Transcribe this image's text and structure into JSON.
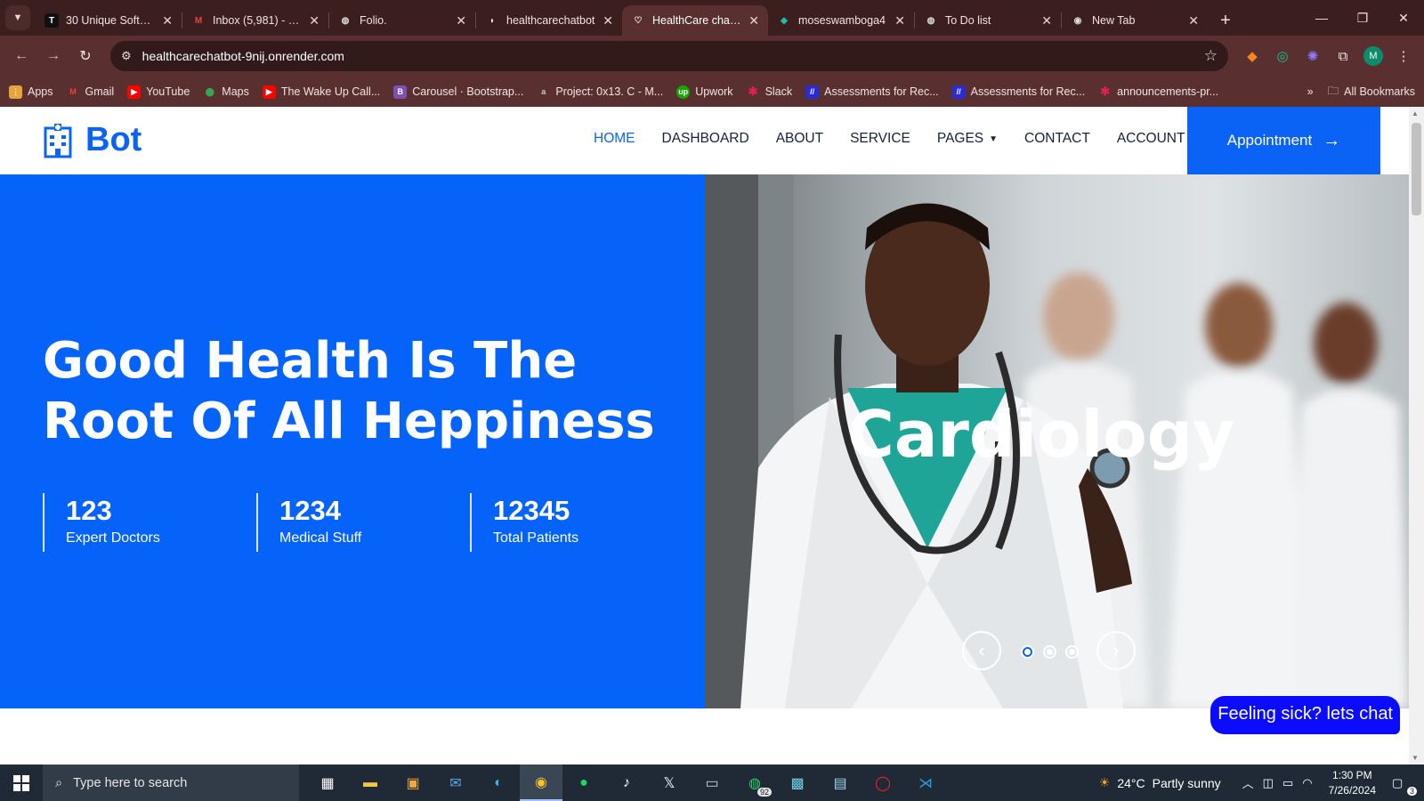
{
  "browser": {
    "tabs": [
      {
        "title": "30 Unique Software",
        "icon": "t-icon",
        "active": false
      },
      {
        "title": "Inbox (5,981) - mo",
        "icon": "gmail-icon",
        "active": false
      },
      {
        "title": "Folio.",
        "icon": "globe-icon",
        "active": false
      },
      {
        "title": "healthcarechatbot",
        "icon": "render-icon",
        "active": false
      },
      {
        "title": "HealthCare chatbot",
        "icon": "heart-icon",
        "active": true
      },
      {
        "title": "moseswamboga4",
        "icon": "diamond-icon",
        "active": false
      },
      {
        "title": "To Do list",
        "icon": "globe-icon",
        "active": false
      },
      {
        "title": "New Tab",
        "icon": "chrome-icon",
        "active": false
      }
    ],
    "url": "healthcarechatbot-9nij.onrender.com",
    "profile_initial": "M",
    "bookmarks": [
      {
        "label": "Apps",
        "icon": "apps-grid-icon",
        "color": "#e8a33a"
      },
      {
        "label": "Gmail",
        "icon": "gmail-icon",
        "color": "#d93025"
      },
      {
        "label": "YouTube",
        "icon": "youtube-icon",
        "color": "#ff0000"
      },
      {
        "label": "Maps",
        "icon": "maps-pin-icon",
        "color": "#34a853"
      },
      {
        "label": "The Wake Up Call...",
        "icon": "youtube-icon",
        "color": "#ff0000"
      },
      {
        "label": "Carousel · Bootstrap...",
        "icon": "bootstrap-icon",
        "color": "#7952b3"
      },
      {
        "label": "Project: 0x13. C - M...",
        "icon": "alx-icon",
        "color": "#333333"
      },
      {
        "label": "Upwork",
        "icon": "upwork-icon",
        "color": "#14a800"
      },
      {
        "label": "Slack",
        "icon": "slack-icon",
        "color": "#e01e5a"
      },
      {
        "label": "Assessments for Rec...",
        "icon": "assessment-icon",
        "color": "#2b2bd6"
      },
      {
        "label": "Assessments for Rec...",
        "icon": "assessment-icon",
        "color": "#2b2bd6"
      },
      {
        "label": "announcements-pr...",
        "icon": "slack-icon",
        "color": "#e01e5a"
      }
    ],
    "all_bookmarks_label": "All Bookmarks"
  },
  "site": {
    "brand": "Bot",
    "nav": [
      {
        "label": "HOME",
        "active": true,
        "dropdown": false
      },
      {
        "label": "DASHBOARD",
        "active": false,
        "dropdown": false
      },
      {
        "label": "ABOUT",
        "active": false,
        "dropdown": false
      },
      {
        "label": "SERVICE",
        "active": false,
        "dropdown": false
      },
      {
        "label": "PAGES",
        "active": false,
        "dropdown": true
      },
      {
        "label": "CONTACT",
        "active": false,
        "dropdown": false
      },
      {
        "label": "ACCOUNT",
        "active": false,
        "dropdown": true
      }
    ],
    "appointment_label": "Appointment",
    "hero": {
      "title_line1": "Good Health Is The",
      "title_line2": "Root Of All Heppiness",
      "stats": [
        {
          "value": "123",
          "label": "Expert Doctors"
        },
        {
          "value": "1234",
          "label": "Medical Stuff"
        },
        {
          "value": "12345",
          "label": "Total Patients"
        }
      ]
    },
    "carousel": {
      "slide_title": "Cardiology",
      "slide_count": 3,
      "active_slide": 1
    },
    "chat_button": "Feeling sick? lets chat",
    "colors": {
      "primary": "#0b63f6",
      "hero_bg": "#0563fa",
      "chat_bg": "#0b0bff"
    }
  },
  "taskbar": {
    "search_placeholder": "Type here to search",
    "whatsapp_badge": "92",
    "weather_temp": "24°C",
    "weather_text": "Partly sunny",
    "time": "1:30 PM",
    "date": "7/26/2024",
    "notification_count": "3"
  }
}
